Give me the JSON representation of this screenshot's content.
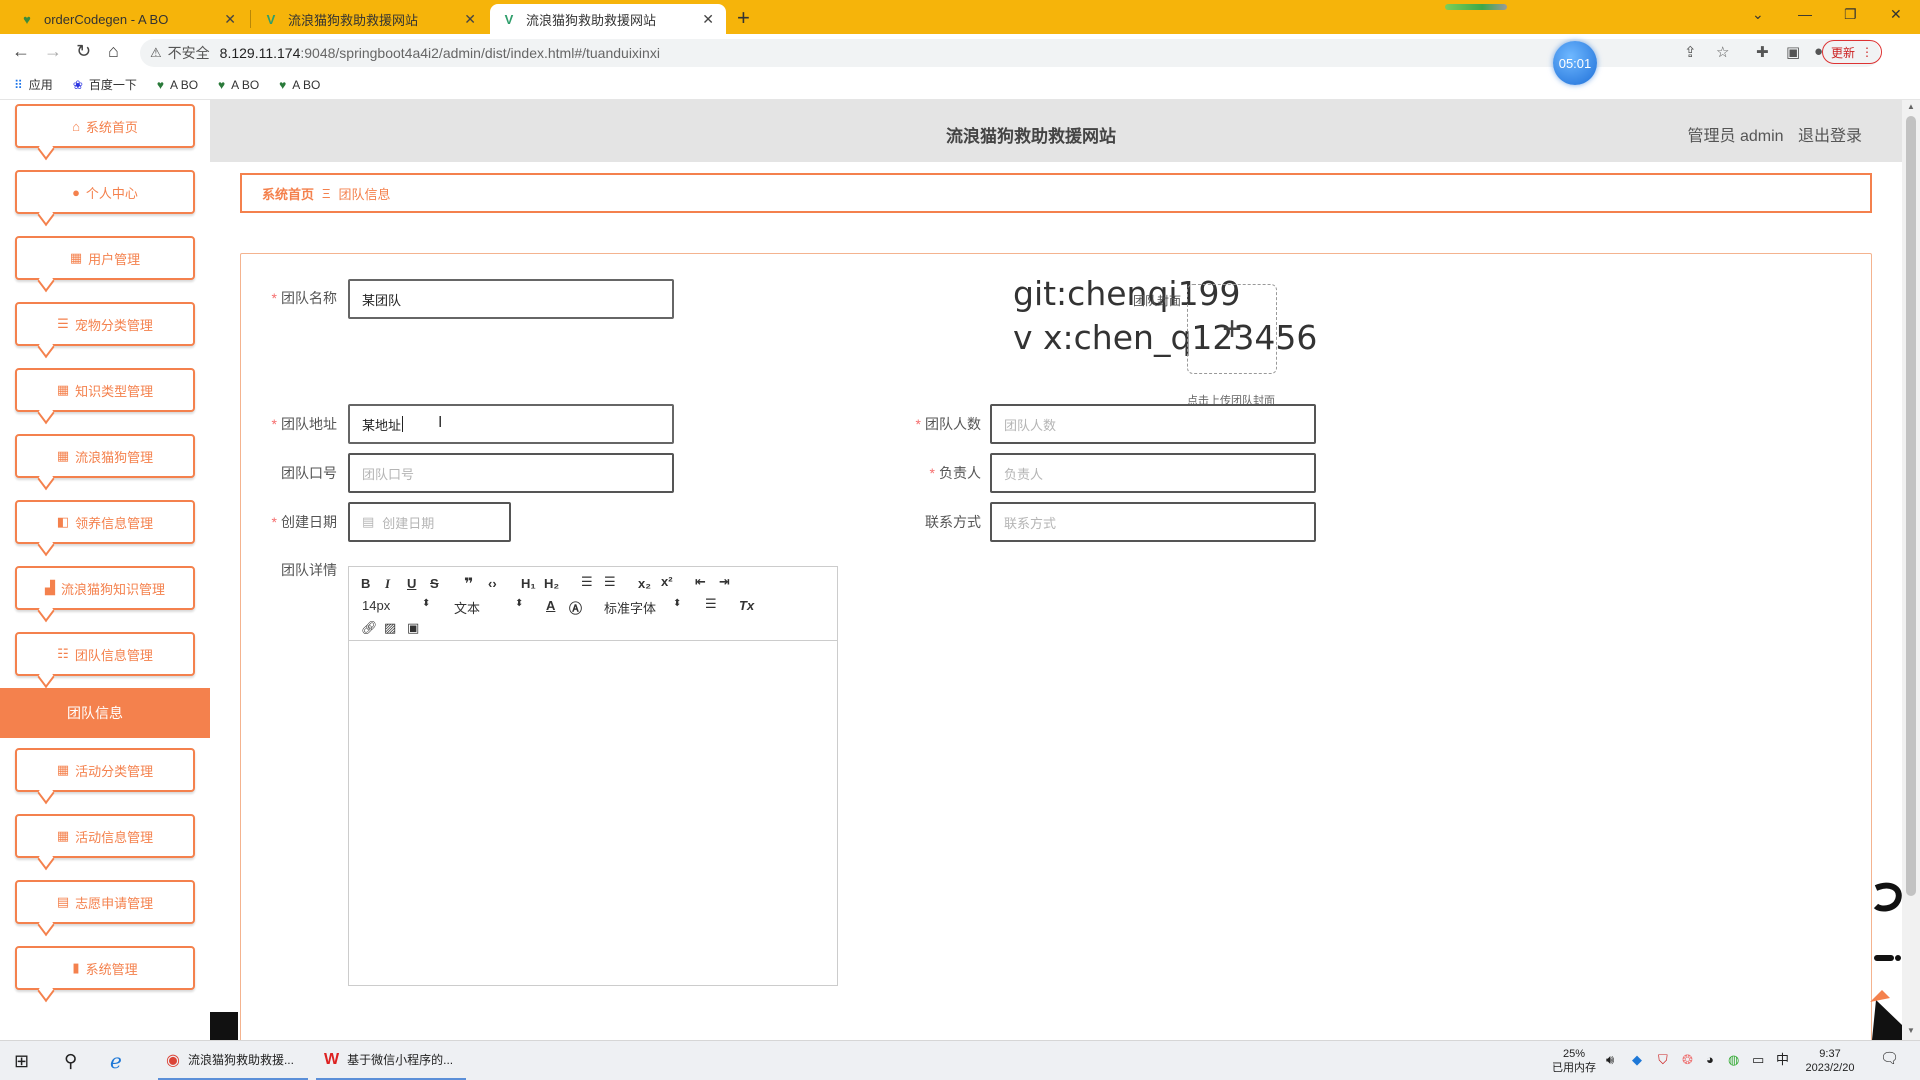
{
  "browser": {
    "tabs": [
      {
        "title": "orderCodegen - A BO",
        "active": false
      },
      {
        "title": "流浪猫狗救助救援网站",
        "active": false
      },
      {
        "title": "流浪猫狗救助救援网站",
        "active": true
      }
    ],
    "insecure_label": "不安全",
    "url_host": "8.129.11.174",
    "url_path": ":9048/springboot4a4i2/admin/dist/index.html#/tuanduixinxi",
    "timer": "05:01",
    "update_label": "更新",
    "bookmarks": [
      "应用",
      "百度一下",
      "A BO",
      "A BO",
      "A BO"
    ]
  },
  "header": {
    "site_title": "流浪猫狗救助救援网站",
    "admin_label": "管理员 admin",
    "logout_label": "退出登录"
  },
  "sidebar": {
    "items": [
      {
        "label": "系统首页",
        "icon": "home-icon"
      },
      {
        "label": "个人中心",
        "icon": "user-icon"
      },
      {
        "label": "用户管理",
        "icon": "grid-icon"
      },
      {
        "label": "宠物分类管理",
        "icon": "list-icon"
      },
      {
        "label": "知识类型管理",
        "icon": "grid-icon"
      },
      {
        "label": "流浪猫狗管理",
        "icon": "grid-icon"
      },
      {
        "label": "领养信息管理",
        "icon": "ticket-icon"
      },
      {
        "label": "流浪猫狗知识管理",
        "icon": "briefcase-icon"
      },
      {
        "label": "团队信息管理",
        "icon": "sliders-icon"
      },
      {
        "label": "活动分类管理",
        "icon": "grid-icon"
      },
      {
        "label": "活动信息管理",
        "icon": "grid-icon"
      },
      {
        "label": "志愿申请管理",
        "icon": "clipboard-icon"
      },
      {
        "label": "系统管理",
        "icon": "bar-chart-icon"
      }
    ],
    "active_submenu": "团队信息"
  },
  "breadcrumb": {
    "home": "系统首页",
    "separator": "Ξ",
    "current": "团队信息"
  },
  "form": {
    "team_name": {
      "label": "团队名称",
      "required": true,
      "value": "某团队"
    },
    "team_cover": {
      "label": "团队封面",
      "tip": "点击上传团队封面"
    },
    "team_address": {
      "label": "团队地址",
      "required": true,
      "value": "某地址"
    },
    "team_count": {
      "label": "团队人数",
      "required": true,
      "placeholder": "团队人数"
    },
    "team_slogan": {
      "label": "团队口号",
      "required": false,
      "placeholder": "团队口号"
    },
    "leader": {
      "label": "负责人",
      "required": true,
      "placeholder": "负责人"
    },
    "created_date": {
      "label": "创建日期",
      "required": true,
      "placeholder": "创建日期"
    },
    "contact": {
      "label": "联系方式",
      "required": false,
      "placeholder": "联系方式"
    },
    "details": {
      "label": "团队详情"
    }
  },
  "editor": {
    "font_size": "14px",
    "text_type": "文本",
    "font_family": "标准字体"
  },
  "watermark": {
    "line1": "git:chenqi199",
    "line2": "v x:chen_q123456"
  },
  "taskbar": {
    "apps": [
      {
        "label": "流浪猫狗救助救援..."
      },
      {
        "label": "基于微信小程序的..."
      }
    ],
    "memory_percent": "25%",
    "memory_label": "已用内存",
    "ime": "中",
    "time": "9:37",
    "date": "2023/2/20"
  },
  "colors": {
    "accent": "#f4814d",
    "tabbar": "#f6b40a",
    "header_bg": "#e4e4e4"
  }
}
